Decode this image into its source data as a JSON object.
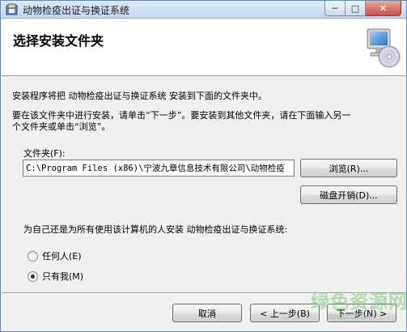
{
  "window": {
    "title": "动物检疫出证与换证系统",
    "min_glyph": "─",
    "max_glyph": "□",
    "close_glyph": "✕"
  },
  "header": {
    "title": "选择安装文件夹"
  },
  "body": {
    "line1": "安装程序将把 动物检疫出证与换证系统 安装到下面的文件夹中。",
    "line2": "要在该文件夹中进行安装，请单击“下一步”。要安装到其他文件夹，请在下面输入另一",
    "line3": "个文件夹或单击“浏览”。",
    "folder_label": "文件夹(F):",
    "folder_value": "C:\\Program Files (x86)\\宁波九章信息技术有限公司\\动物检疫",
    "browse_label": "浏览(R)...",
    "disk_cost_label": "磁盘开销(D)...",
    "question": "为自己还是为所有使用该计算机的人安装 动物检疫出证与换证系统:",
    "radio_everyone": "任何人(E)",
    "radio_just_me": "只有我(M)",
    "selected_option": "just_me"
  },
  "footer": {
    "cancel_label": "取消",
    "back_label": "< 上一步(B)",
    "next_label": "下一步(N) >"
  },
  "watermark": {
    "main": "绿色资源网",
    "sub": "downcc.com"
  },
  "icons": {
    "app": "installer-app-icon",
    "header": "computer-cd-icon"
  }
}
